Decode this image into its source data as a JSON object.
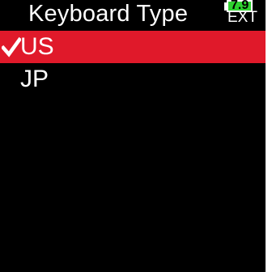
{
  "screen": {
    "title": "Keyboard Type",
    "battery": {
      "voltage": "7.9",
      "source": "EXT",
      "level": 1.0,
      "fill_color": "#2fd12f"
    }
  },
  "options": [
    {
      "label": "US",
      "selected": true,
      "icon": "checkmark-icon"
    },
    {
      "label": "JP",
      "selected": false
    }
  ],
  "colors": {
    "background": "#000000",
    "selection": "#e0192a",
    "text": "#ffffff"
  }
}
